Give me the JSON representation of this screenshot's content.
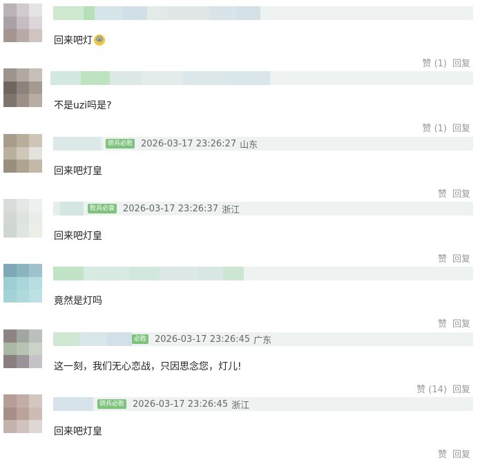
{
  "comments": [
    {
      "badge": "",
      "timestamp": "",
      "location": "",
      "text": "回来吧灯",
      "emoji": "crying-face",
      "like_label": "赞",
      "like_count": "(1)",
      "reply_label": "回复"
    },
    {
      "badge": "",
      "timestamp": "",
      "location": "",
      "text": "不是uzi吗是?",
      "emoji": "",
      "like_label": "赞",
      "like_count": "(1)",
      "reply_label": "回复"
    },
    {
      "badge": "骄兵必败",
      "timestamp": "2026-03-17 23:26:27",
      "location": "山东",
      "text": "回来吧灯皇",
      "emoji": "",
      "like_label": "赞",
      "like_count": "",
      "reply_label": "回复"
    },
    {
      "badge": "败兵必衰",
      "timestamp": "2026-03-17 23:26:37",
      "location": "浙江",
      "text": "回来吧灯皇",
      "emoji": "",
      "like_label": "赞",
      "like_count": "",
      "reply_label": "回复"
    },
    {
      "badge": "",
      "timestamp": "",
      "location": "",
      "text": "竟然是灯吗",
      "emoji": "",
      "like_label": "赞",
      "like_count": "",
      "reply_label": "回复"
    },
    {
      "badge": "必胜",
      "timestamp": "2026-03-17 23:26:45",
      "location": "广东",
      "text": "这一刻，我们无心恋战，只因思念您，灯儿!",
      "emoji": "",
      "like_label": "赞",
      "like_count": "(14)",
      "reply_label": "回复"
    },
    {
      "badge": "骄兵必败",
      "timestamp": "2026-03-17 23:26:45",
      "location": "浙江",
      "text": "回来吧灯皇",
      "emoji": "",
      "like_label": "赞",
      "like_count": "",
      "reply_label": "回复"
    }
  ],
  "colors": {
    "header_bg": "#eef3f1",
    "badge_bg": "#7ec27e",
    "meta_text": "#666666",
    "action_text": "#999999"
  }
}
